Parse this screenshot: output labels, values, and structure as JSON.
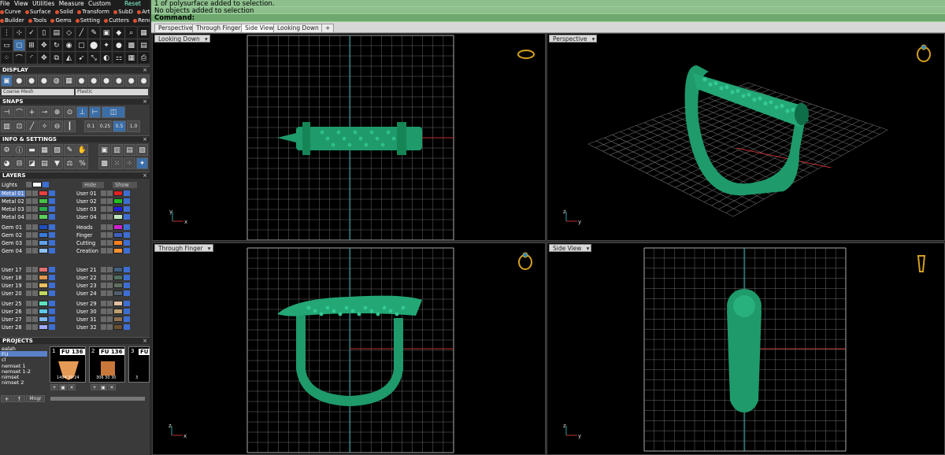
{
  "menu": {
    "items": [
      "File",
      "View",
      "Utilities",
      "Measure",
      "Custom"
    ],
    "reset": "Reset"
  },
  "toolbar_row1": [
    "Curve",
    "Surface",
    "Solid",
    "Transform",
    "SubD",
    "Art"
  ],
  "toolbar_row2": [
    "Builder",
    "Tools",
    "Gems",
    "Setting",
    "Cutters",
    "Render"
  ],
  "sections": {
    "display": "DISPLAY",
    "snaps": "SNAPS",
    "info": "INFO & SETTINGS",
    "layers": "LAYERS",
    "projects": "PROJECTS"
  },
  "display": {
    "mesh": "Coarse Mesh",
    "material": "Plastic"
  },
  "snaps": {
    "values": [
      "0.1",
      "0.25",
      "0.5",
      "1.0"
    ]
  },
  "layers": {
    "lights": "Lights",
    "hide": "Hide",
    "show": "Show",
    "left": [
      {
        "name": "Metal 01",
        "color": "#e84040",
        "sel": true
      },
      {
        "name": "Metal 02",
        "color": "#46c046"
      },
      {
        "name": "Metal 03",
        "color": "#2aaa4a"
      },
      {
        "name": "Metal 04",
        "color": "#5ad05a"
      },
      {
        "name": "Gem 01",
        "color": "#2050c0"
      },
      {
        "name": "Gem 02",
        "color": "#3a7ad8"
      },
      {
        "name": "Gem 03",
        "color": "#60a0e8"
      },
      {
        "name": "Gem 04",
        "color": "#8ec0f0"
      },
      {
        "name": "User 17",
        "color": "#e07070"
      },
      {
        "name": "User 18",
        "color": "#e09850"
      },
      {
        "name": "User 19",
        "color": "#e8c060"
      },
      {
        "name": "User 20",
        "color": "#c0d860"
      },
      {
        "name": "User 25",
        "color": "#60e0c0"
      },
      {
        "name": "User 26",
        "color": "#60c8e8"
      },
      {
        "name": "User 27",
        "color": "#80b8f0"
      },
      {
        "name": "User 28",
        "color": "#a0a8f8"
      }
    ],
    "right": [
      {
        "name": "User 01",
        "color": "#e02020"
      },
      {
        "name": "User 02",
        "color": "#20c020"
      },
      {
        "name": "User 03",
        "color": "#2020e0"
      },
      {
        "name": "User 04",
        "color": "#c0e8c0"
      },
      {
        "name": "Heads",
        "color": "#d020d0"
      },
      {
        "name": "Finger",
        "color": "#4060c0"
      },
      {
        "name": "Cutting",
        "color": "#ff8020"
      },
      {
        "name": "Creation",
        "color": "#ff9030"
      },
      {
        "name": "User 21",
        "color": "#406080"
      },
      {
        "name": "User 22",
        "color": "#507060"
      },
      {
        "name": "User 23",
        "color": "#607060"
      },
      {
        "name": "User 24",
        "color": "#506070"
      },
      {
        "name": "User 29",
        "color": "#e0c0a0"
      },
      {
        "name": "User 30",
        "color": "#c0a070"
      },
      {
        "name": "User 31",
        "color": "#907050"
      },
      {
        "name": "User 32",
        "color": "#6a5030"
      }
    ]
  },
  "projects": {
    "items": [
      "ealah",
      "FU",
      "cl",
      "nemset 1",
      "nemset 1-2",
      "nimset",
      "nimset 2"
    ],
    "selected": 1,
    "thumbs": [
      {
        "num": "1",
        "label": "FU 136",
        "cap": "1404 30 24"
      },
      {
        "num": "2",
        "label": "FU 136",
        "cap": "306 30 30"
      },
      {
        "num": "3",
        "label": "FU",
        "cap": "3"
      }
    ],
    "mngr": "Mngr"
  },
  "command": {
    "line1": "1 of polysurface added to selection.",
    "line2": "No objects added to selection",
    "prompt": "Command:"
  },
  "tabs": [
    "Perspective",
    "Through Finger",
    "Side View",
    "Looking Down"
  ],
  "viewports": {
    "top": "Looking Down",
    "persp": "Perspective",
    "front": "Through Finger",
    "side": "Side View"
  },
  "axes": {
    "x": "x",
    "y": "y",
    "z": "z"
  },
  "colors": {
    "model": "#1f9a6a",
    "grid": "#6a6a6a",
    "gridbold": "#aaaaaa",
    "xaxis": "#c03030",
    "yaxis": "#2aa0a0",
    "badge": "#d4a020"
  }
}
